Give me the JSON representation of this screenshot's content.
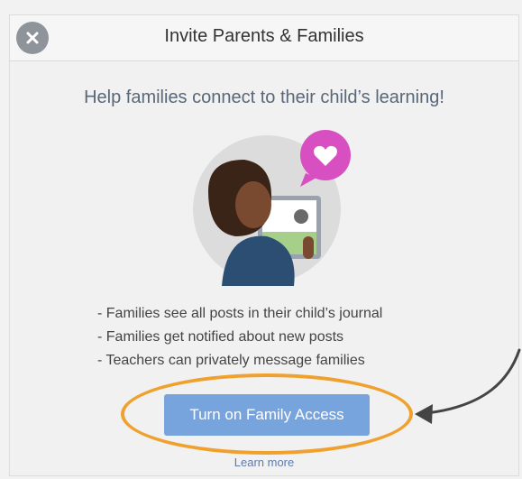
{
  "modal": {
    "title": "Invite Parents & Families",
    "subtitle": "Help families connect to their child’s learning!",
    "bullets": [
      "Families see all posts in their child’s journal",
      "Families get notified about new posts",
      "Teachers can privately message families"
    ],
    "cta_label": "Turn on Family Access",
    "learn_more": "Learn more"
  },
  "icons": {
    "close": "close-icon",
    "heart": "heart-icon"
  },
  "colors": {
    "cta": "#78a4de",
    "highlight": "#f0a12d",
    "heart_bubble": "#d84fc2",
    "subtitle": "#58677a"
  }
}
